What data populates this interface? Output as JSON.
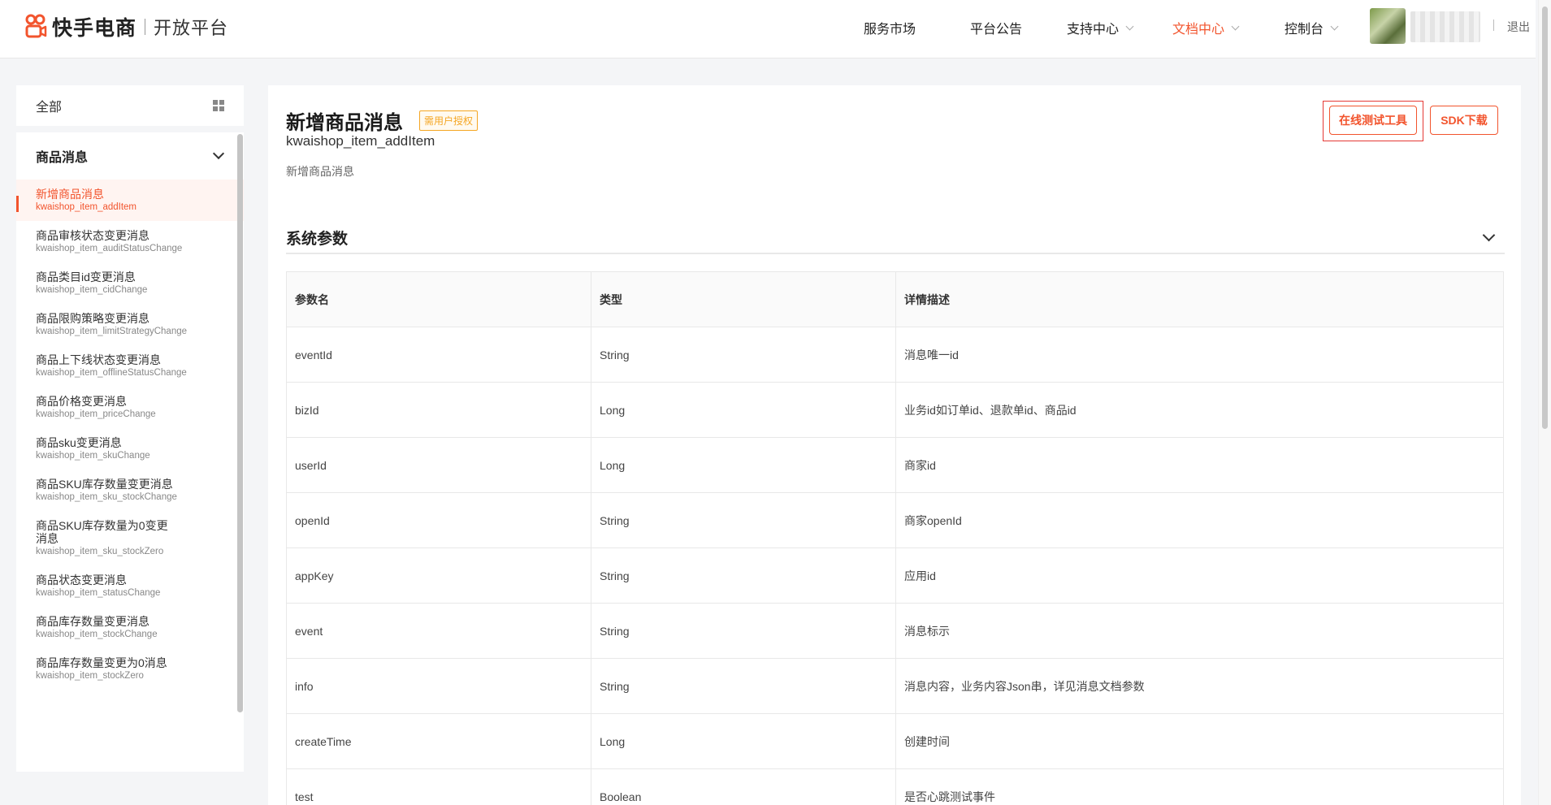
{
  "header": {
    "brand": "快手电商",
    "subtitle": "开放平台",
    "nav": [
      {
        "label": "服务市场",
        "dropdown": false,
        "active": false
      },
      {
        "label": "平台公告",
        "dropdown": false,
        "active": false
      },
      {
        "label": "支持中心",
        "dropdown": true,
        "active": false
      },
      {
        "label": "文档中心",
        "dropdown": true,
        "active": true
      },
      {
        "label": "控制台",
        "dropdown": true,
        "active": false
      }
    ],
    "logout": "退出"
  },
  "sidebar": {
    "all_label": "全部",
    "group_label": "商品消息",
    "items": [
      {
        "title": "新增商品消息",
        "sub": "kwaishop_item_addItem",
        "active": true
      },
      {
        "title": "商品审核状态变更消息",
        "sub": "kwaishop_item_auditStatusChange"
      },
      {
        "title": "商品类目id变更消息",
        "sub": "kwaishop_item_cidChange"
      },
      {
        "title": "商品限购策略变更消息",
        "sub": "kwaishop_item_limitStrategyChange"
      },
      {
        "title": "商品上下线状态变更消息",
        "sub": "kwaishop_item_offlineStatusChange"
      },
      {
        "title": "商品价格变更消息",
        "sub": "kwaishop_item_priceChange"
      },
      {
        "title": "商品sku变更消息",
        "sub": "kwaishop_item_skuChange"
      },
      {
        "title": "商品SKU库存数量变更消息",
        "sub": "kwaishop_item_sku_stockChange"
      },
      {
        "title": "商品SKU库存数量为0变更消息",
        "sub": "kwaishop_item_sku_stockZero"
      },
      {
        "title": "商品状态变更消息",
        "sub": "kwaishop_item_statusChange"
      },
      {
        "title": "商品库存数量变更消息",
        "sub": "kwaishop_item_stockChange"
      },
      {
        "title": "商品库存数量变更为0消息",
        "sub": "kwaishop_item_stockZero"
      }
    ]
  },
  "main": {
    "title": "新增商品消息",
    "badge": "需用户授权",
    "method": "kwaishop_item_addItem",
    "description": "新增商品消息",
    "test_tool_label": "在线测试工具",
    "sdk_label": "SDK下载",
    "section_title": "系统参数",
    "table": {
      "headers": [
        "参数名",
        "类型",
        "详情描述"
      ],
      "rows": [
        [
          "eventId",
          "String",
          "消息唯一id"
        ],
        [
          "bizId",
          "Long",
          "业务id如订单id、退款单id、商品id"
        ],
        [
          "userId",
          "Long",
          "商家id"
        ],
        [
          "openId",
          "String",
          "商家openId"
        ],
        [
          "appKey",
          "String",
          "应用id"
        ],
        [
          "event",
          "String",
          "消息标示"
        ],
        [
          "info",
          "String",
          "消息内容，业务内容Json串，详见消息文档参数"
        ],
        [
          "createTime",
          "Long",
          "创建时间"
        ],
        [
          "test",
          "Boolean",
          "是否心跳测试事件"
        ]
      ]
    }
  },
  "colors": {
    "accent": "#f2542d",
    "badge": "#f5a623",
    "highlight": "#e53935"
  }
}
